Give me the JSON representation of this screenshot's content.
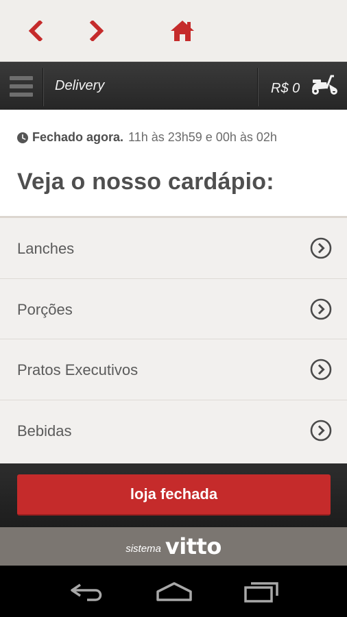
{
  "top_nav": {
    "back_icon": "chevron-left-icon",
    "forward_icon": "chevron-right-icon",
    "home_icon": "home-icon",
    "accent_color": "#c52b2b"
  },
  "header": {
    "menu_icon": "hamburger-icon",
    "title": "Delivery",
    "cart_total": "R$ 0",
    "cart_icon": "scooter-icon"
  },
  "hours": {
    "icon": "clock-icon",
    "status": "Fechado agora.",
    "times": "11h às 23h59 e 00h às 02h"
  },
  "page_title": "Veja o nosso cardápio:",
  "menu": {
    "items": [
      {
        "label": "Lanches"
      },
      {
        "label": "Porções"
      },
      {
        "label": "Pratos Executivos"
      },
      {
        "label": "Bebidas"
      }
    ],
    "item_icon": "chevron-circle-right-icon"
  },
  "footer": {
    "button_label": "loja fechada",
    "button_color": "#c52b2b"
  },
  "brand": {
    "prefix": "sistema",
    "logo": "vitto"
  },
  "system_nav": {
    "back_icon": "back-arrow-icon",
    "home_icon": "home-outline-icon",
    "recent_icon": "recent-apps-icon"
  }
}
